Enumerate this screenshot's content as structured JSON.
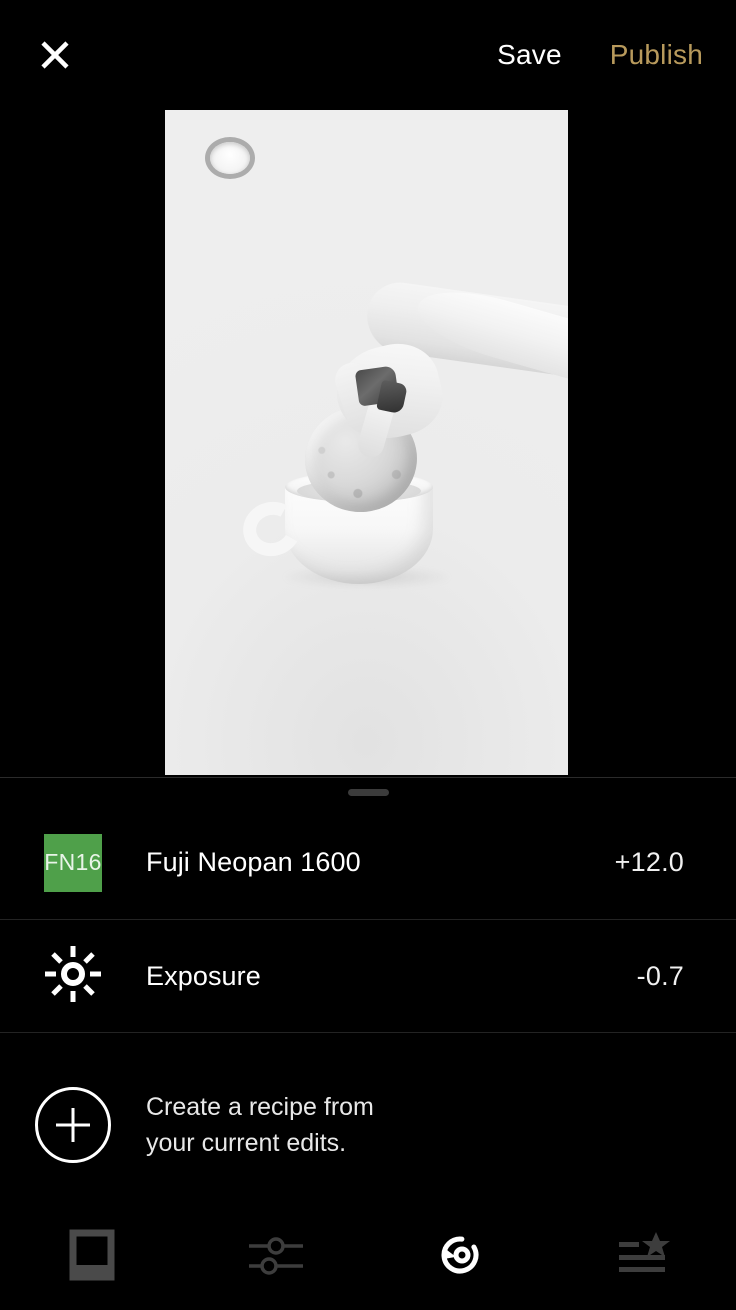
{
  "app": {
    "screen_name": "Photo Editor",
    "background": "#000000"
  },
  "topbar": {
    "close_icon": "close-icon",
    "save_label": "Save",
    "publish_label": "Publish",
    "save_color": "#ffffff",
    "publish_color": "#b89a5c"
  },
  "photo": {
    "description": "Black and white photo of a hand dipping a donut into a white cup of coffee",
    "background": "#ebebeb"
  },
  "handle": {
    "name": "drag-handle",
    "color": "#3b3b3b"
  },
  "edits": {
    "rows": [
      {
        "icon_type": "swatch",
        "swatch_text": "FN16",
        "swatch_color": "#4fa04a",
        "label": "Fuji Neopan 1600",
        "value": "+12.0"
      },
      {
        "icon_type": "brightness-icon",
        "swatch_text": "",
        "swatch_color": "",
        "label": "Exposure",
        "value": "-0.7"
      }
    ]
  },
  "recipe": {
    "icon": "plus-circle-icon",
    "line1": "Create a recipe from",
    "line2": "your current edits."
  },
  "toolbar": {
    "items": [
      {
        "name": "crop-frame-icon",
        "label": "Crop",
        "active": false,
        "color": "#4a4a4a"
      },
      {
        "name": "adjust-sliders-icon",
        "label": "Adjust",
        "active": false,
        "color": "#3d3d3d"
      },
      {
        "name": "undo-history-icon",
        "label": "History",
        "active": true,
        "color": "#ffffff"
      },
      {
        "name": "recipes-star-icon",
        "label": "Recipes",
        "active": false,
        "color": "#3d3d3d"
      }
    ]
  }
}
